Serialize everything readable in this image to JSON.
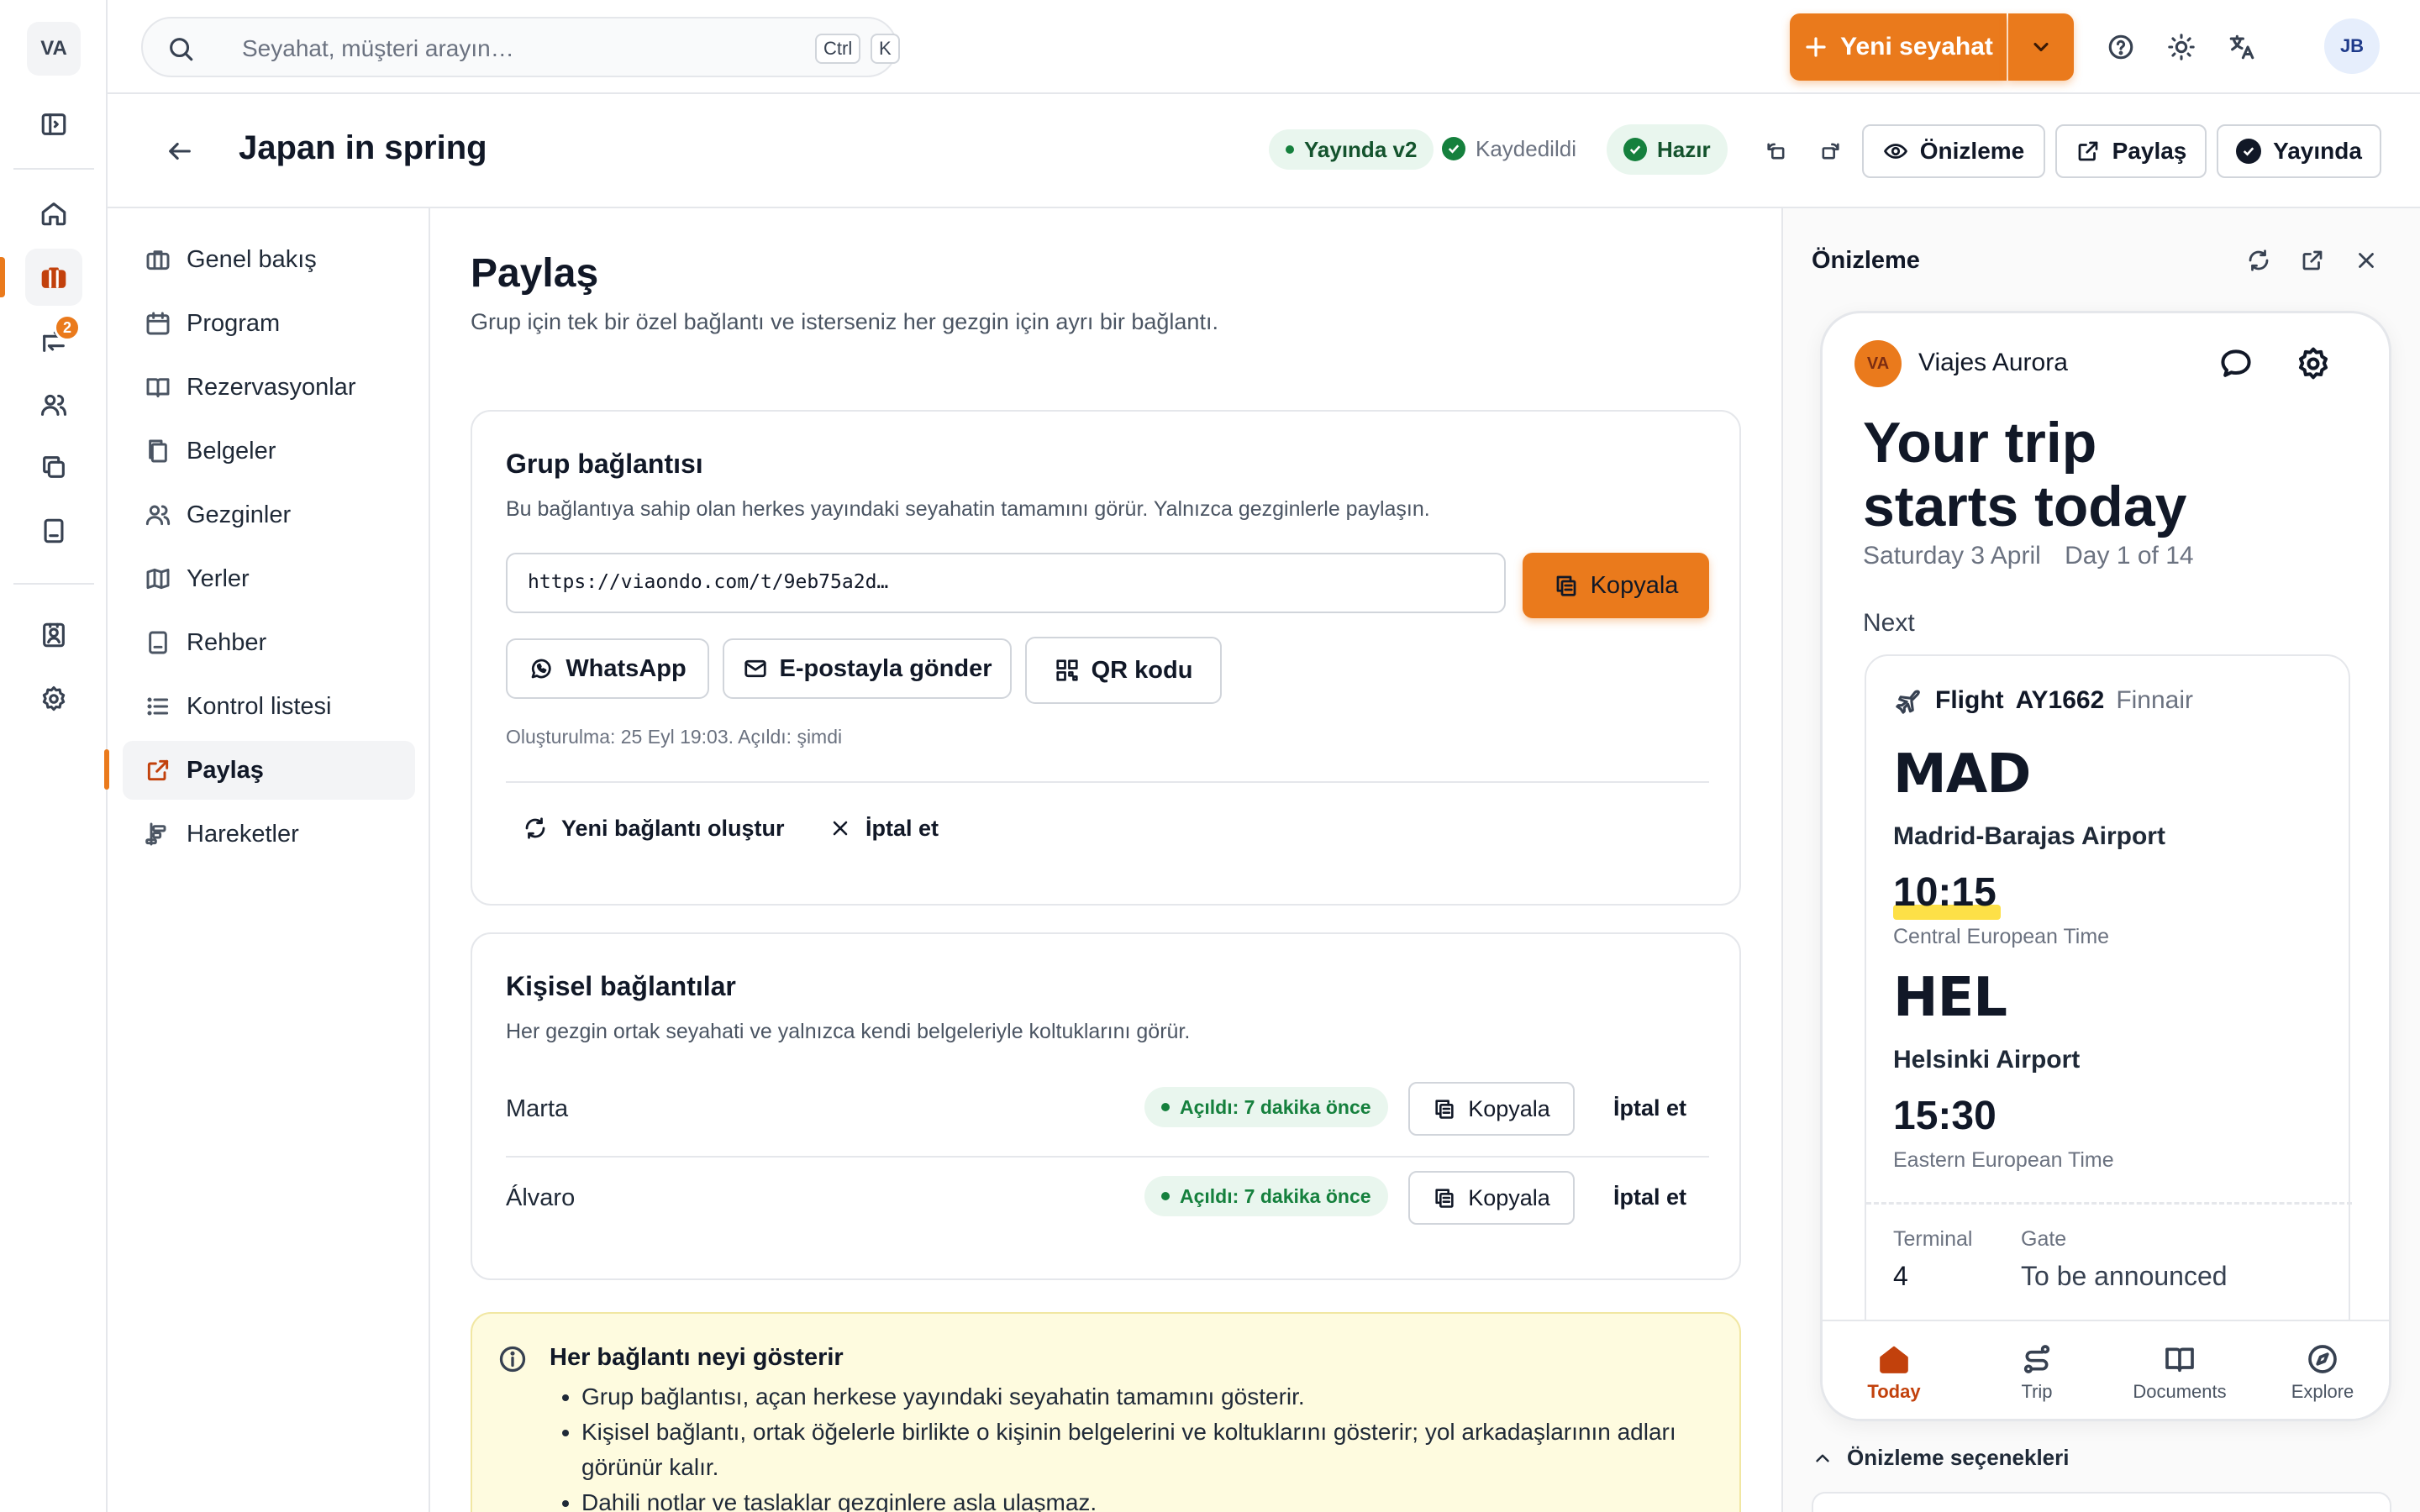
{
  "rail": {
    "logo": "VA",
    "badge_count": "2"
  },
  "search": {
    "placeholder": "Seyahat, müşteri arayın…",
    "kbd1": "Ctrl",
    "kbd2": "K"
  },
  "topbar": {
    "new_trip": "Yeni seyahat",
    "avatar": "JB"
  },
  "titlebar": {
    "title": "Japan in spring",
    "status_published": "Yayında v2",
    "status_saved": "Kaydedildi",
    "status_ready": "Hazır",
    "preview_btn": "Önizleme",
    "share_btn": "Paylaş",
    "publish_btn": "Yayında"
  },
  "subnav": {
    "items": [
      {
        "label": "Genel bakış",
        "icon": "briefcase-icon"
      },
      {
        "label": "Program",
        "icon": "calendar-icon"
      },
      {
        "label": "Rezervasyonlar",
        "icon": "book-icon"
      },
      {
        "label": "Belgeler",
        "icon": "documents-icon"
      },
      {
        "label": "Gezginler",
        "icon": "users-icon"
      },
      {
        "label": "Yerler",
        "icon": "map-icon"
      },
      {
        "label": "Rehber",
        "icon": "guide-icon"
      },
      {
        "label": "Kontrol listesi",
        "icon": "list-icon"
      },
      {
        "label": "Paylaş",
        "icon": "share-icon"
      },
      {
        "label": "Hareketler",
        "icon": "activity-icon"
      }
    ]
  },
  "main": {
    "title": "Paylaş",
    "lead": "Grup için tek bir özel bağlantı ve isterseniz her gezgin için ayrı bir bağlantı.",
    "group": {
      "title": "Grup bağlantısı",
      "subtitle": "Bu bağlantıya sahip olan herkes yayındaki seyahatin tamamını görür. Yalnızca gezginlerle paylaşın.",
      "url": "https://viaondo.com/t/9eb75a2d…",
      "copy": "Kopyala",
      "whatsapp": "WhatsApp",
      "email": "E-postayla gönder",
      "qr": "QR kodu",
      "meta": "Oluşturulma: 25 Eyl 19:03. Açıldı: şimdi",
      "regenerate": "Yeni bağlantı oluştur",
      "revoke": "İptal et"
    },
    "personal": {
      "title": "Kişisel bağlantılar",
      "subtitle": "Her gezgin ortak seyahati ve yalnızca kendi belgeleriyle koltuklarını görür.",
      "rows": [
        {
          "name": "Marta",
          "status": "Açıldı: 7 dakika önce",
          "copy": "Kopyala",
          "revoke": "İptal et"
        },
        {
          "name": "Álvaro",
          "status": "Açıldı: 7 dakika önce",
          "copy": "Kopyala",
          "revoke": "İptal et"
        }
      ]
    },
    "info": {
      "title": "Her bağlantı neyi gösterir",
      "items": [
        "Grup bağlantısı, açan herkese yayındaki seyahatin tamamını gösterir.",
        "Kişisel bağlantı, ortak öğelerle birlikte o kişinin belgelerini ve koltuklarını gösterir; yol arkadaşlarının adları görünür kalır.",
        "Dahili notlar ve taslaklar gezginlere asla ulaşmaz."
      ]
    }
  },
  "preview": {
    "title": "Önizleme",
    "options": "Önizleme seçenekleri",
    "phone": {
      "logo": "VA",
      "brand": "Viajes Aurora",
      "headline1": "Your trip",
      "headline2": "starts today",
      "date": "Saturday 3 April",
      "day": "Day 1 of 14",
      "next": "Next",
      "flight": {
        "label": "Flight",
        "number": "AY1662",
        "airline": "Finnair",
        "from_code": "MAD",
        "from_airport": "Madrid-Barajas Airport",
        "dep_time": "10:15",
        "from_tz": "Central European Time",
        "to_code": "HEL",
        "to_airport": "Helsinki Airport",
        "arr_time": "15:30",
        "to_tz": "Eastern European Time",
        "terminal_label": "Terminal",
        "terminal": "4",
        "gate_label": "Gate",
        "gate": "To be announced"
      },
      "tabs": [
        "Today",
        "Trip",
        "Documents",
        "Explore"
      ]
    }
  },
  "colors": {
    "accent": "#ea7a1c",
    "success": "#15803d",
    "info_bg": "#fefbdf"
  }
}
